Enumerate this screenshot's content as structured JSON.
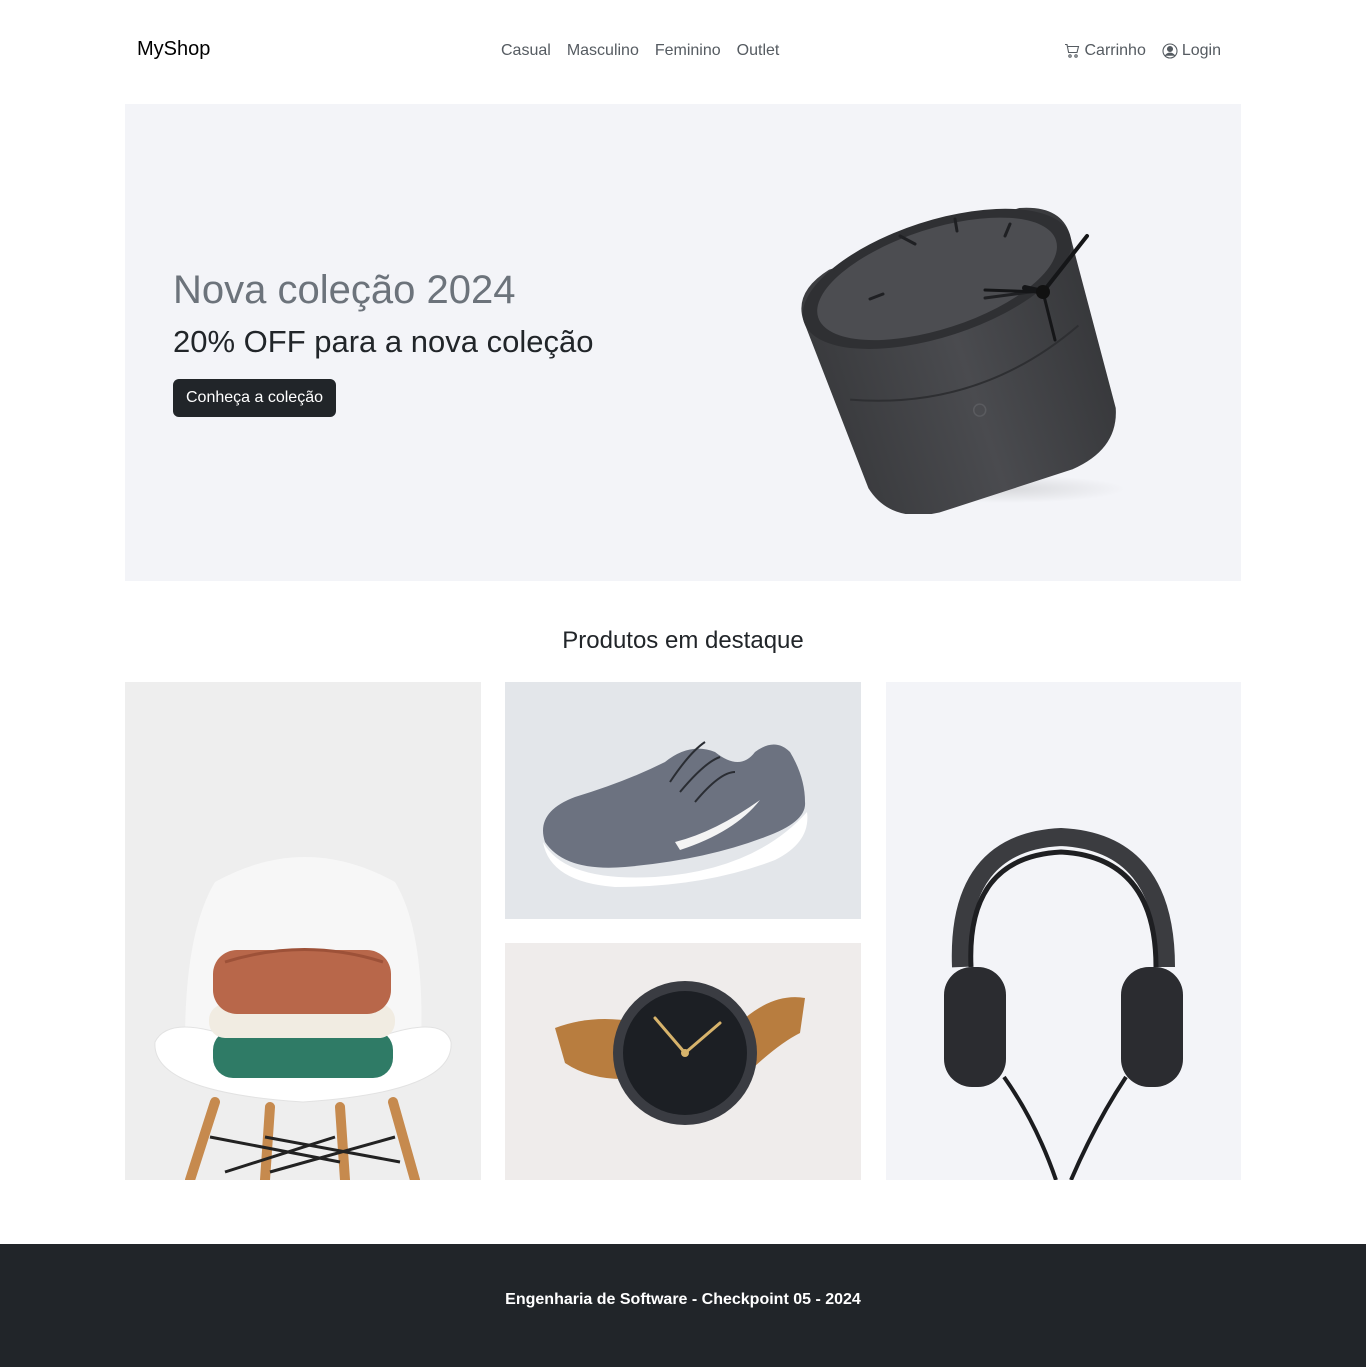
{
  "navbar": {
    "brand": "MyShop",
    "links": [
      {
        "label": "Casual"
      },
      {
        "label": "Masculino"
      },
      {
        "label": "Feminino"
      },
      {
        "label": "Outlet"
      }
    ],
    "cart_label": "Carrinho",
    "login_label": "Login",
    "cart_icon": "cart-icon",
    "login_icon": "person-circle-icon"
  },
  "hero": {
    "title": "Nova coleção 2024",
    "subtitle": "20% OFF para a nova coleção",
    "button_label": "Conheça a coleção",
    "image": "desk-clock"
  },
  "featured": {
    "title": "Produtos em destaque",
    "products": [
      {
        "image": "folded-sweaters-on-chair"
      },
      {
        "image": "running-sneaker"
      },
      {
        "image": "wristwatch"
      },
      {
        "image": "headphones"
      }
    ]
  },
  "footer": {
    "text": "Engenharia de Software - Checkpoint 05 - 2024"
  },
  "colors": {
    "hero_bg": "#f3f4f8",
    "dark": "#212529",
    "muted_text": "#6c737b"
  }
}
